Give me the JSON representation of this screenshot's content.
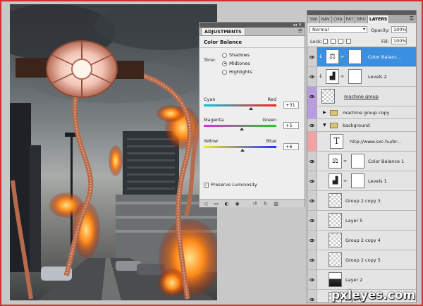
{
  "adjustments_panel": {
    "tab_label": "ADJUSTMENTS",
    "title": "Color Balance",
    "tone_label": "Tone:",
    "tone_options": [
      "Shadows",
      "Midtones",
      "Highlights"
    ],
    "selected_tone": "Midtones",
    "sliders": [
      {
        "left_label": "Cyan",
        "right_label": "Red",
        "value": "+31",
        "colors": [
          "#00c8d8",
          "#ff1a1a"
        ]
      },
      {
        "left_label": "Magenta",
        "right_label": "Green",
        "value": "+5",
        "colors": [
          "#e02ad8",
          "#20d020"
        ]
      },
      {
        "left_label": "Yellow",
        "right_label": "Blue",
        "value": "+6",
        "colors": [
          "#f4e820",
          "#2030ff"
        ]
      }
    ],
    "preserve_luminosity_label": "Preserve Luminosity",
    "preserve_luminosity_checked": true
  },
  "layers_panel": {
    "tabs": [
      "SWI",
      "NAV",
      "CHA",
      "PAT",
      "BRU",
      "LAYERS"
    ],
    "active_tab": "LAYERS",
    "blend_mode": "Normal",
    "opacity_label": "Opacity:",
    "opacity_value": "100%",
    "lock_label": "Lock:",
    "fill_label": "Fill:",
    "fill_value": "100%",
    "layers": [
      {
        "name": "Color Balance 2",
        "display_name": "Color Balanc...",
        "kind": "adjustment",
        "selected": true,
        "clipped": true
      },
      {
        "name": "Levels 2",
        "kind": "adjustment",
        "clipped": true
      },
      {
        "name": "machine group",
        "kind": "smart",
        "underline": true
      },
      {
        "name": "machine group copy",
        "kind": "group"
      },
      {
        "name": "background",
        "kind": "group-open"
      },
      {
        "name": "http://www.sxc.hu/br...",
        "kind": "type"
      },
      {
        "name": "Color Balance 1",
        "kind": "adjustment"
      },
      {
        "name": "Levels 1",
        "kind": "adjustment"
      },
      {
        "name": "Group 2 copy 3",
        "kind": "pixel"
      },
      {
        "name": "Layer 5",
        "kind": "pixel"
      },
      {
        "name": "Group 2 copy 4",
        "kind": "pixel"
      },
      {
        "name": "Group 2 copy 5",
        "kind": "pixel"
      },
      {
        "name": "Layer 2",
        "kind": "pixel-dark"
      },
      {
        "name": "Layer 6",
        "kind": "pixel"
      }
    ]
  },
  "watermark": "pxleyes.com",
  "colors": {
    "selection": "#3b8fe0",
    "purple_tag": "#b79ce0",
    "pink_tag": "#f0a3a3"
  }
}
